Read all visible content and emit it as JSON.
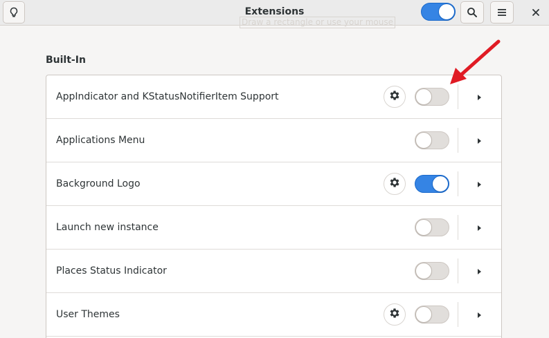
{
  "window": {
    "title": "Extensions",
    "tooltip": "Draw a rectangle or use your mouse",
    "global_switch_on": true
  },
  "header": {
    "tips_icon": "lightbulb-icon",
    "search_icon": "search-icon",
    "menu_icon": "hamburger-menu-icon",
    "close_icon": "close-icon"
  },
  "section": {
    "title": "Built-In"
  },
  "extensions": [
    {
      "name": "AppIndicator and KStatusNotifierItem Support",
      "has_settings": true,
      "enabled": false
    },
    {
      "name": "Applications Menu",
      "has_settings": false,
      "enabled": false
    },
    {
      "name": "Background Logo",
      "has_settings": true,
      "enabled": true
    },
    {
      "name": "Launch new instance",
      "has_settings": false,
      "enabled": false
    },
    {
      "name": "Places Status Indicator",
      "has_settings": false,
      "enabled": false
    },
    {
      "name": "User Themes",
      "has_settings": true,
      "enabled": false
    }
  ],
  "colors": {
    "accent": "#3584e4",
    "annotation_arrow": "#e01b24"
  }
}
